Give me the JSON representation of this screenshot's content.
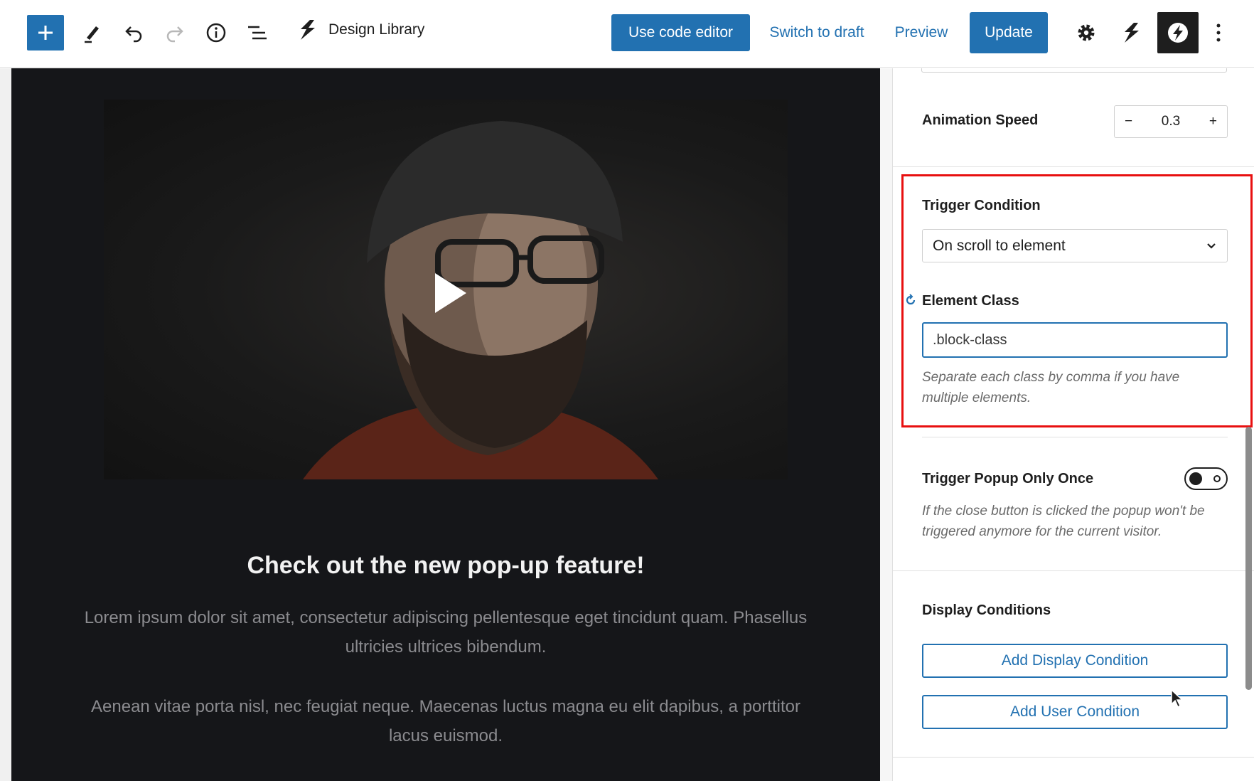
{
  "toolbar": {
    "brand_label": "Design Library",
    "code_editor_label": "Use code editor",
    "switch_draft_label": "Switch to draft",
    "preview_label": "Preview",
    "update_label": "Update"
  },
  "canvas": {
    "headline": "Check out the new pop-up feature!",
    "paragraph1": "Lorem ipsum dolor sit amet, consectetur adipiscing pellentesque eget tincidunt quam. Phasellus ultricies ultrices bibendum.",
    "paragraph2": "Aenean vitae porta nisl, nec feugiat neque. Maecenas luctus magna eu elit dapibus, a porttitor lacus euismod."
  },
  "panel": {
    "animation_speed_label": "Animation Speed",
    "animation_speed_value": "0.3",
    "trigger_condition_label": "Trigger Condition",
    "trigger_condition_value": "On scroll to element",
    "element_class_label": "Element Class",
    "element_class_value": ".block-class",
    "element_class_help": "Separate each class by comma if you have multiple elements.",
    "trigger_once_label": "Trigger Popup Only Once",
    "trigger_once_help": "If the close button is clicked the popup won't be triggered anymore for the current visitor.",
    "trigger_once_enabled": false,
    "display_conditions_label": "Display Conditions",
    "add_display_condition_label": "Add Display Condition",
    "add_user_condition_label": "Add User Condition"
  },
  "colors": {
    "accent": "#2271b1",
    "highlight": "#e81010",
    "canvas_bg": "#151619"
  }
}
